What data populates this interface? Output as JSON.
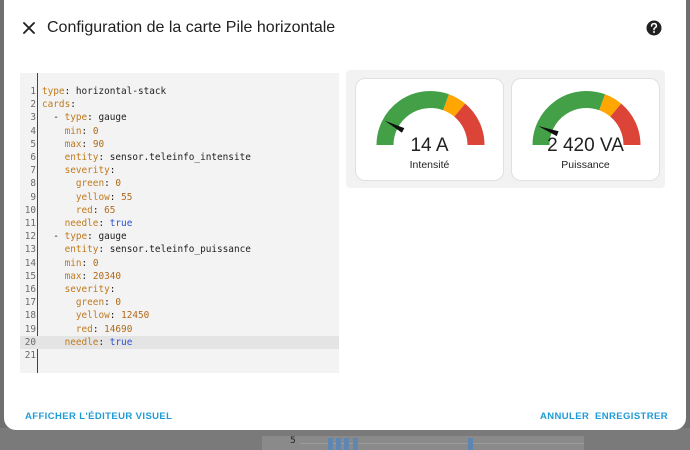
{
  "dialog": {
    "title": "Configuration de la carte Pile horizontale",
    "icons": {
      "close": "close-icon",
      "help": "help-circle-icon"
    }
  },
  "editor": {
    "lines": [
      {
        "n": "1",
        "k": "type",
        "v": "horizontal-stack",
        "t": "s",
        "indent": ""
      },
      {
        "n": "2",
        "k": "cards",
        "v": "",
        "t": "s",
        "indent": ""
      },
      {
        "n": "3",
        "k": "type",
        "v": "gauge",
        "t": "s",
        "indent": "  - "
      },
      {
        "n": "4",
        "k": "min",
        "v": "0",
        "t": "n",
        "indent": "    "
      },
      {
        "n": "5",
        "k": "max",
        "v": "90",
        "t": "n",
        "indent": "    "
      },
      {
        "n": "6",
        "k": "entity",
        "v": "sensor.teleinfo_intensite",
        "t": "s",
        "indent": "    "
      },
      {
        "n": "7",
        "k": "severity",
        "v": "",
        "t": "s",
        "indent": "    "
      },
      {
        "n": "8",
        "k": "green",
        "v": "0",
        "t": "n",
        "indent": "      "
      },
      {
        "n": "9",
        "k": "yellow",
        "v": "55",
        "t": "n",
        "indent": "      "
      },
      {
        "n": "10",
        "k": "red",
        "v": "65",
        "t": "n",
        "indent": "      "
      },
      {
        "n": "11",
        "k": "needle",
        "v": "true",
        "t": "b",
        "indent": "    "
      },
      {
        "n": "12",
        "k": "type",
        "v": "gauge",
        "t": "s",
        "indent": "  - "
      },
      {
        "n": "13",
        "k": "entity",
        "v": "sensor.teleinfo_puissance",
        "t": "s",
        "indent": "    "
      },
      {
        "n": "14",
        "k": "min",
        "v": "0",
        "t": "n",
        "indent": "    "
      },
      {
        "n": "15",
        "k": "max",
        "v": "20340",
        "t": "n",
        "indent": "    "
      },
      {
        "n": "16",
        "k": "severity",
        "v": "",
        "t": "s",
        "indent": "    "
      },
      {
        "n": "17",
        "k": "green",
        "v": "0",
        "t": "n",
        "indent": "      "
      },
      {
        "n": "18",
        "k": "yellow",
        "v": "12450",
        "t": "n",
        "indent": "      "
      },
      {
        "n": "19",
        "k": "red",
        "v": "14690",
        "t": "n",
        "indent": "      "
      },
      {
        "n": "20",
        "k": "needle",
        "v": "true",
        "t": "b",
        "indent": "    ",
        "active": true
      },
      {
        "n": "21",
        "k": "",
        "v": "",
        "t": "s",
        "indent": ""
      }
    ]
  },
  "preview": {
    "gauges": [
      {
        "value_text": "14 A",
        "name": "Intensité",
        "value": 14,
        "min": 0,
        "max": 90,
        "yellow": 55,
        "red": 65
      },
      {
        "value_text": "2 420 VA",
        "name": "Puissance",
        "value": 2420,
        "min": 0,
        "max": 20340,
        "yellow": 12450,
        "red": 14690
      }
    ],
    "colors": {
      "green": "#43a047",
      "yellow": "#ffa600",
      "red": "#db4437"
    }
  },
  "footer": {
    "show_visual": "AFFICHER L'ÉDITEUR VISUEL",
    "cancel": "ANNULER",
    "save": "ENREGISTRER"
  },
  "background": {
    "axis_tick": "5"
  }
}
